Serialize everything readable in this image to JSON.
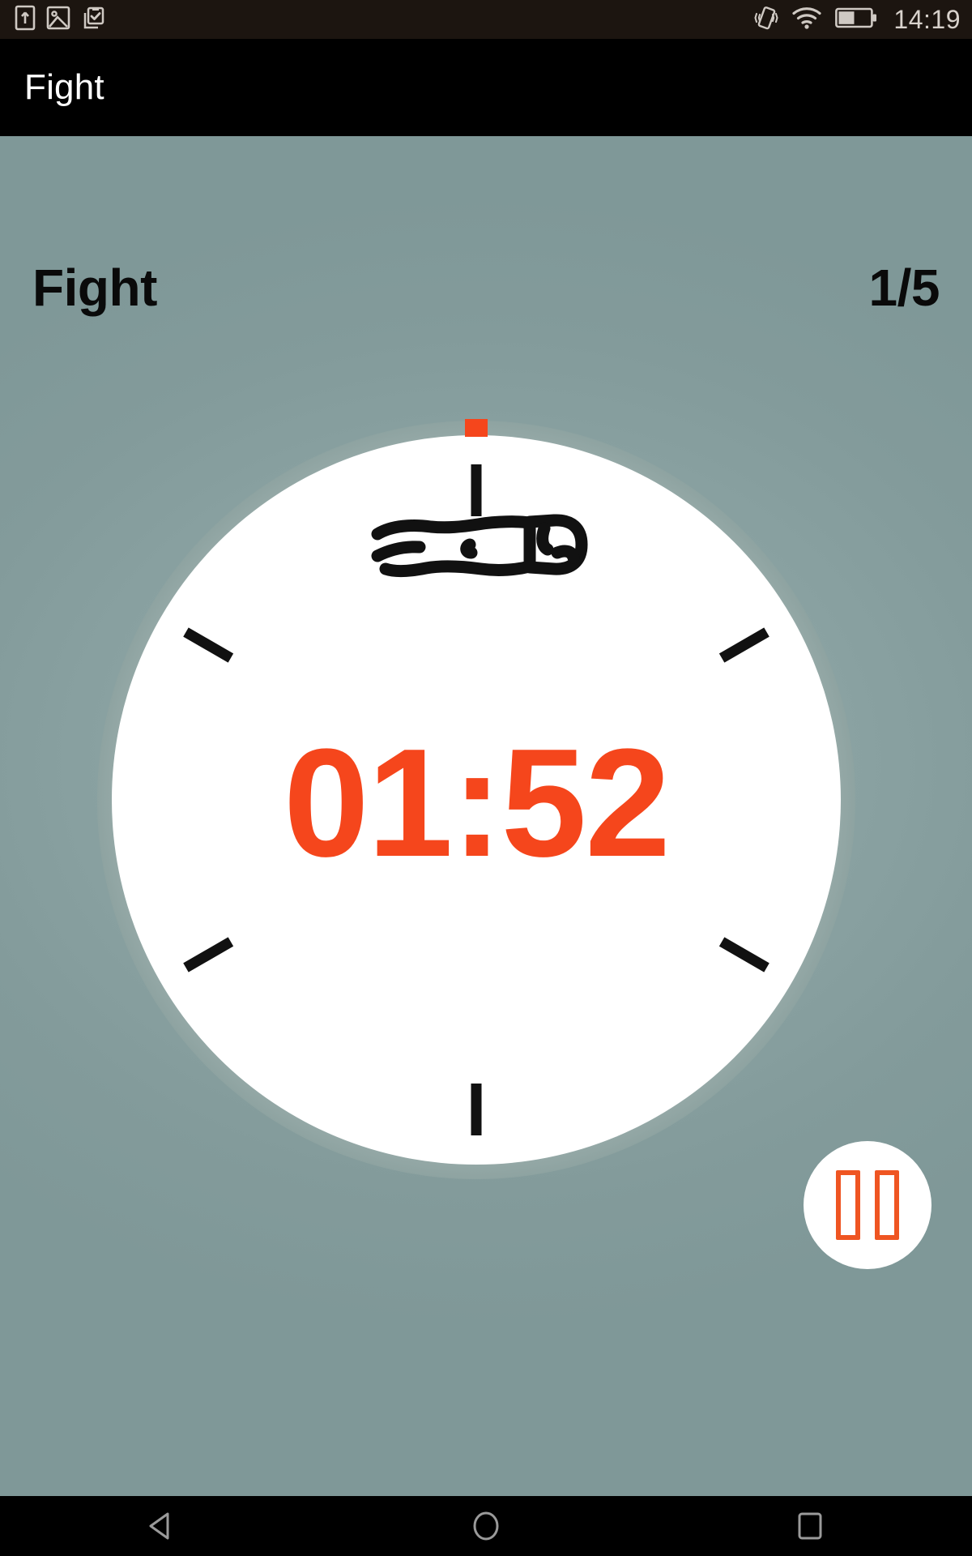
{
  "status_bar": {
    "icons_left": [
      "sim-card-icon",
      "screenshot-image-icon",
      "clipboard-check-icon"
    ],
    "icons_right": [
      "vibrate-mode-icon",
      "wifi-icon",
      "battery-icon"
    ],
    "battery_level_percent": 50,
    "time": "14:19"
  },
  "app_bar": {
    "title": "Fight"
  },
  "header": {
    "phase_label": "Fight",
    "round_counter": "1/5"
  },
  "timer": {
    "phase_icon": "boxing-glove-icon",
    "time_remaining": "01:52",
    "progress_marker_angle_deg": 0,
    "tick_count": 6,
    "colors": {
      "accent": "#f5461c",
      "dial_face": "#ffffff",
      "dial_ring": "#92a6a4",
      "background": "#8ba3a3",
      "tick": "#111111"
    }
  },
  "controls": {
    "pause_button_label": "pause-button",
    "pause_icon": "pause-icon"
  },
  "nav_bar": {
    "back_label": "back-icon",
    "home_label": "home-icon",
    "recents_label": "recents-icon"
  }
}
